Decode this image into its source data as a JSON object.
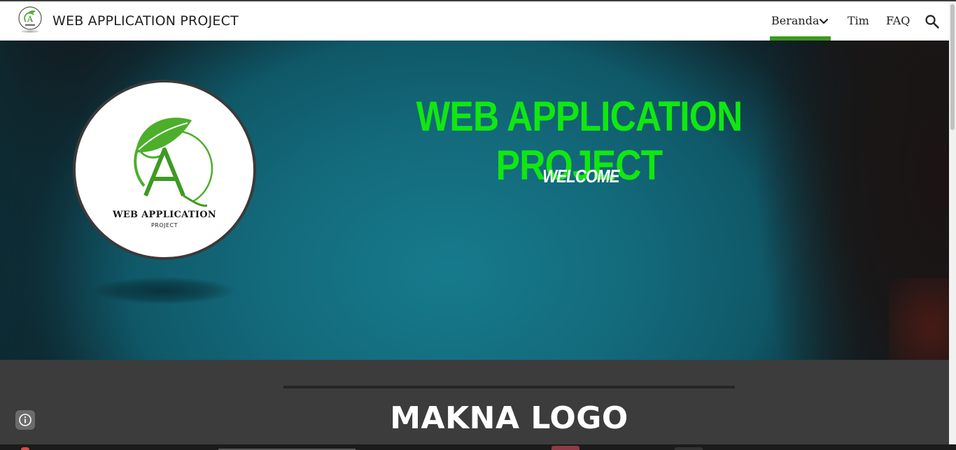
{
  "header": {
    "site_title": "WEB APPLICATION PROJECT",
    "nav": [
      {
        "label": "Beranda",
        "active": true,
        "has_dropdown": true
      },
      {
        "label": "Tim",
        "active": false
      },
      {
        "label": "FAQ",
        "active": false
      }
    ],
    "search_icon": "search-icon",
    "accent_color": "#3d9a1f"
  },
  "hero": {
    "title": "WEB APPLICATION PROJECT",
    "subtitle": "WELCOME",
    "title_color": "#10e810",
    "logo": {
      "letter": "A",
      "main_text": "WEB APPLICATION",
      "sub_text": "PROJECT",
      "leaf_color": "#4caf2a"
    }
  },
  "section": {
    "heading": "MAKNA LOGO"
  },
  "info_icon": "info-icon"
}
